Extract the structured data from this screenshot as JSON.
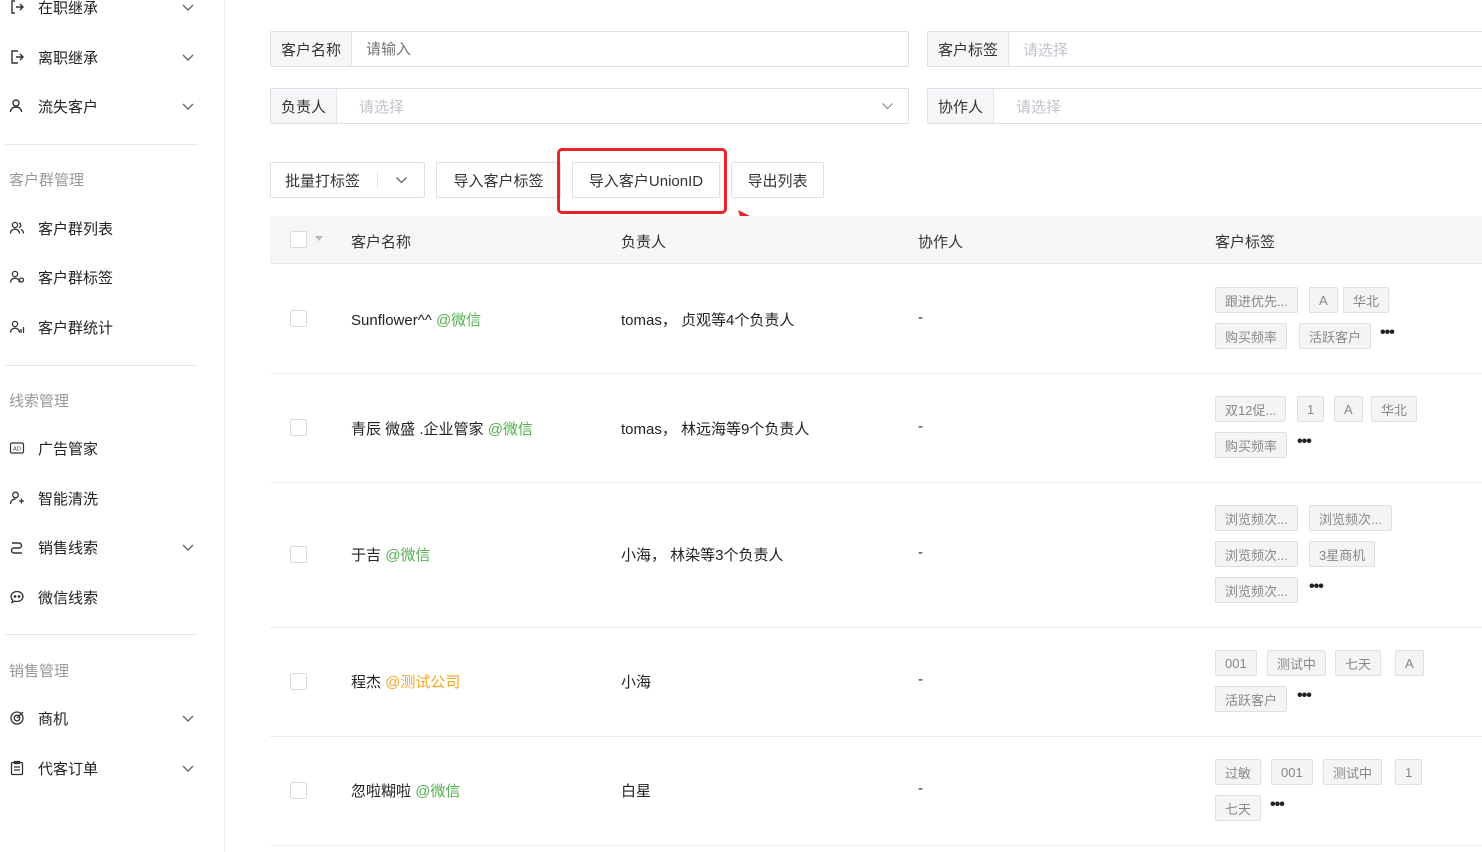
{
  "sidebar": {
    "items": [
      {
        "label": "在职继承",
        "icon": "exit-icon",
        "expandable": true
      },
      {
        "label": "离职继承",
        "icon": "logout-icon",
        "expandable": true
      },
      {
        "label": "流失客户",
        "icon": "user-icon",
        "expandable": true
      }
    ],
    "sections": [
      {
        "title": "客户群管理",
        "items": [
          {
            "label": "客户群列表",
            "icon": "group-icon"
          },
          {
            "label": "客户群标签",
            "icon": "group-tag-icon"
          },
          {
            "label": "客户群统计",
            "icon": "group-stat-icon"
          }
        ]
      },
      {
        "title": "线索管理",
        "items": [
          {
            "label": "广告管家",
            "icon": "ad-icon"
          },
          {
            "label": "智能清洗",
            "icon": "user-clean-icon"
          },
          {
            "label": "销售线索",
            "icon": "lead-icon",
            "expandable": true
          },
          {
            "label": "微信线索",
            "icon": "wechat-icon"
          }
        ]
      },
      {
        "title": "销售管理",
        "items": [
          {
            "label": "商机",
            "icon": "target-icon",
            "expandable": true
          },
          {
            "label": "代客订单",
            "icon": "clipboard-icon",
            "expandable": true
          }
        ]
      }
    ]
  },
  "filters": {
    "customer_name": {
      "label": "客户名称",
      "placeholder": "请输入"
    },
    "customer_tag": {
      "label": "客户标签",
      "placeholder": "请选择"
    },
    "owner": {
      "label": "负责人",
      "placeholder": "请选择"
    },
    "collaborator": {
      "label": "协作人",
      "placeholder": "请选择"
    }
  },
  "toolbar": {
    "batch_tag": "批量打标签",
    "import_tags": "导入客户标签",
    "import_unionid": "导入客户UnionID",
    "export_list": "导出列表"
  },
  "table": {
    "columns": [
      "客户名称",
      "负责人",
      "协作人",
      "客户标签"
    ],
    "rows": [
      {
        "name": "Sunflower^^",
        "corp": "@微信",
        "owner": "tomas， 贞观等4个负责人",
        "collab": "-",
        "tags": [
          "跟进优先...",
          "A",
          "华北",
          "购买频率",
          "活跃客户"
        ]
      },
      {
        "name": "青辰 微盛 .企业管家",
        "corp": "@微信",
        "owner": "tomas， 林远海等9个负责人",
        "collab": "-",
        "tags": [
          "双12促...",
          "1",
          "A",
          "华北",
          "购买频率"
        ]
      },
      {
        "name": "于吉",
        "corp": "@微信",
        "owner": "小海， 林染等3个负责人",
        "collab": "-",
        "tags": [
          "浏览频次...",
          "浏览频次...",
          "浏览频次...",
          "3星商机",
          "浏览频次..."
        ]
      },
      {
        "name": "程杰",
        "corp": "@测试公司",
        "owner": "小海",
        "collab": "-",
        "tags": [
          "001",
          "测试中",
          "七天",
          "A",
          "活跃客户"
        ]
      },
      {
        "name": "忽啦糊啦",
        "corp": "@微信",
        "owner": "白星",
        "collab": "-",
        "tags": [
          "过敏",
          "001",
          "测试中",
          "1",
          "七天"
        ]
      }
    ],
    "more_symbol": "•••"
  },
  "colors": {
    "wechat": "#52b04f",
    "company": "#f5a623",
    "highlight": "#e8262a"
  }
}
